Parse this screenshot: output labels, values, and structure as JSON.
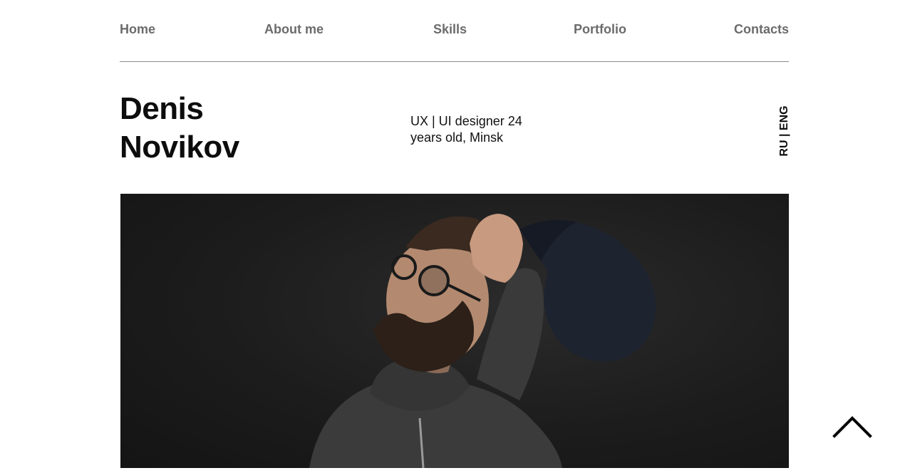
{
  "nav": {
    "items": [
      {
        "label": "Home"
      },
      {
        "label": "About me"
      },
      {
        "label": "Skills"
      },
      {
        "label": "Portfolio"
      },
      {
        "label": "Contacts"
      }
    ]
  },
  "profile": {
    "first_name": "Denis",
    "last_name": "Novikov",
    "tagline": "UX | UI designer 24 years old, Minsk"
  },
  "language": {
    "ru": "RU",
    "separator": " | ",
    "en": "ENG"
  },
  "icons": {
    "scroll_top": "chevron-up-icon"
  },
  "colors": {
    "nav_text": "#6b6b6b",
    "heading": "#0d0d0d",
    "divider": "#8c8c8c",
    "photo_background": "#1c1c1c"
  }
}
